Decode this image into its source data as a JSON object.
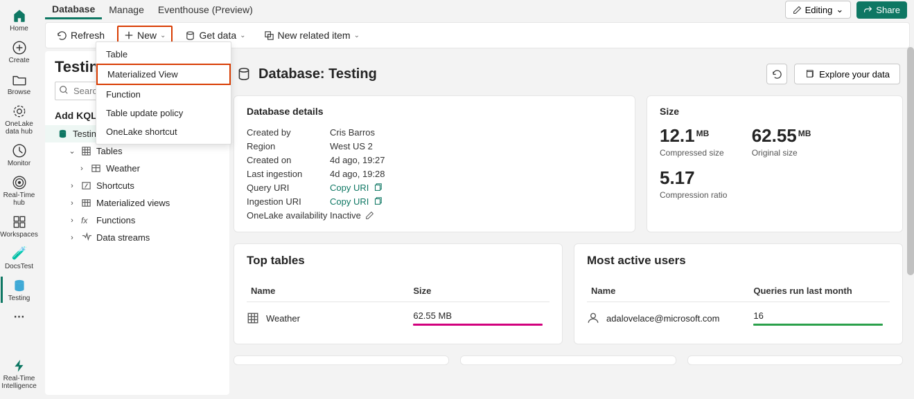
{
  "vnav": {
    "home": "Home",
    "create": "Create",
    "browse": "Browse",
    "onelake": "OneLake data hub",
    "monitor": "Monitor",
    "realtime": "Real-Time hub",
    "workspaces": "Workspaces",
    "docstest": "DocsTest",
    "testing": "Testing",
    "bottom": "Real-Time Intelligence"
  },
  "tabs": {
    "database": "Database",
    "manage": "Manage",
    "eventhouse": "Eventhouse (Preview)"
  },
  "topright": {
    "editing": "Editing",
    "share": "Share"
  },
  "toolbar": {
    "refresh": "Refresh",
    "new": "New",
    "getdata": "Get data",
    "newrelated": "New related item"
  },
  "newmenu": {
    "table": "Table",
    "matview": "Materialized View",
    "function": "Function",
    "tup": "Table update policy",
    "onelake": "OneLake shortcut"
  },
  "lpanel": {
    "title": "Testing",
    "search_ph": "Search",
    "header": "Add KQL data",
    "tree": {
      "testing": "Testing",
      "tables": "Tables",
      "weather": "Weather",
      "shortcuts": "Shortcuts",
      "matviews": "Materialized views",
      "functions": "Functions",
      "datastreams": "Data streams"
    }
  },
  "detail": {
    "title": "Database: Testing",
    "explore": "Explore your data",
    "dbdetails_h": "Database details",
    "kv": {
      "createdby_k": "Created by",
      "createdby_v": "Cris Barros",
      "region_k": "Region",
      "region_v": "West US 2",
      "createdon_k": "Created on",
      "createdon_v": "4d ago, 19:27",
      "lasting_k": "Last ingestion",
      "lasting_v": "4d ago, 19:28",
      "quri_k": "Query URI",
      "quri_v": "Copy URI",
      "iuri_k": "Ingestion URI",
      "iuri_v": "Copy URI",
      "onelake_k": "OneLake availability",
      "onelake_v": "Inactive"
    },
    "size_h": "Size",
    "metrics": {
      "comp_v": "12.1",
      "comp_u": "MB",
      "comp_l": "Compressed size",
      "orig_v": "62.55",
      "orig_u": "MB",
      "orig_l": "Original size",
      "ratio_v": "5.17",
      "ratio_l": "Compression ratio"
    },
    "toptables_h": "Top tables",
    "toptables_cols": {
      "name": "Name",
      "size": "Size"
    },
    "toptables_row": {
      "name": "Weather",
      "size": "62.55 MB"
    },
    "activeusers_h": "Most active users",
    "activeusers_cols": {
      "name": "Name",
      "q": "Queries run last month"
    },
    "activeusers_row": {
      "name": "adalovelace@microsoft.com",
      "q": "16"
    }
  }
}
